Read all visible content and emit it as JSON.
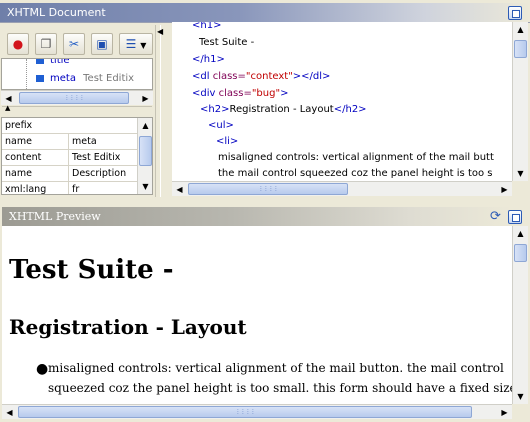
{
  "doc_window": {
    "title": "XHTML Document"
  },
  "preview_window": {
    "title": "XHTML Preview"
  },
  "toolbar": {
    "buttons": [
      {
        "name": "insert-element-button",
        "icon": "tag-icon"
      },
      {
        "name": "copy-button",
        "icon": "copy-icon"
      },
      {
        "name": "cut-button",
        "icon": "scissors-icon"
      },
      {
        "name": "select-button",
        "icon": "select-icon"
      },
      {
        "name": "view-options-button",
        "icon": "list-view-icon"
      }
    ]
  },
  "tree": {
    "items": [
      {
        "label": "title",
        "value": ""
      },
      {
        "label": "meta",
        "value": "Test Editix"
      }
    ]
  },
  "properties": {
    "header": "prefix",
    "rows": [
      {
        "key": "name",
        "value": "meta"
      },
      {
        "key": "content",
        "value": "Test Editix"
      },
      {
        "key": "name",
        "value": "Description"
      },
      {
        "key": "xml:lang",
        "value": "fr"
      }
    ]
  },
  "code": {
    "h1_open": "<h1>",
    "h1_text": "Test Suite  -",
    "h1_close": "</h1>",
    "dl_open": "<dl",
    "dl_attr": " class=",
    "dl_val": "\"context\"",
    "dl_close": "></dl>",
    "div_open": "<div",
    "div_attr": " class=",
    "div_val": "\"bug\"",
    "div_end": ">",
    "h2_open": "<h2>",
    "h2_text": "Registration - Layout",
    "h2_close": "</h2>",
    "ul_open": "<ul>",
    "li_open": "<li>",
    "li_text_1": "misaligned controls: vertical alignment of the mail butt",
    "li_text_2": "the mail control squeezed coz the panel height is too s"
  },
  "preview": {
    "h1": "Test Suite -",
    "h2": "Registration - Layout",
    "bullet_1": "misaligned controls: vertical alignment of the mail button. the mail control",
    "bullet_2": "squeezed coz the panel height is too small. this form should have a fixed size"
  }
}
